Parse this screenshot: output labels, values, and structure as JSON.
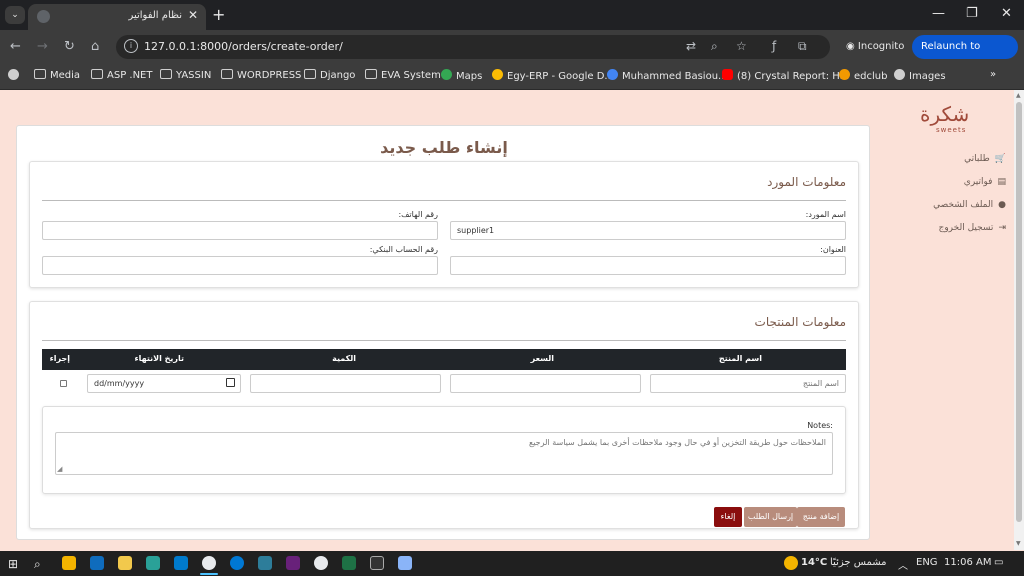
{
  "browser": {
    "tab_title": "نظام الفواتير",
    "url": "127.0.0.1:8000/orders/create-order/",
    "incognito_label": "Incognito",
    "relaunch_label": "Relaunch to update",
    "bookmarks": [
      "Media",
      "ASP .NET",
      "YASSIN",
      "WORDPRESS",
      "Django",
      "EVA System",
      "Maps",
      "Egy-ERP - Google D...",
      "Muhammed Basiou...",
      "(8) Crystal Report: H...",
      "edclub",
      "Images"
    ]
  },
  "sidebar": {
    "logo": "شكرة",
    "logo_sub": "sweets",
    "items": [
      {
        "label": "طلباتي",
        "icon": "cart-icon"
      },
      {
        "label": "فواتيري",
        "icon": "file-icon"
      },
      {
        "label": "الملف الشخصي",
        "icon": "user-icon"
      },
      {
        "label": "تسجيل الخروج",
        "icon": "logout-icon"
      }
    ]
  },
  "page": {
    "title": "إنشاء طلب جديد"
  },
  "supplier": {
    "section_title": "معلومات المورد",
    "name_label": "اسم المورد:",
    "name_value": "supplier1",
    "phone_label": "رقم الهاتف:",
    "phone_value": "",
    "address_label": "العنوان:",
    "address_value": "",
    "bank_label": "رقم الحساب البنكي:",
    "bank_value": ""
  },
  "products": {
    "section_title": "معلومات المنتجات",
    "columns": [
      "اسم المنتج",
      "السعر",
      "الكمية",
      "تاريخ الانتهاء",
      "إجراء"
    ],
    "row": {
      "name_placeholder": "اسم المنتج",
      "price": "",
      "quantity": "",
      "expiry_placeholder": "dd/mm/yyyy"
    },
    "notes_label": "Notes:",
    "notes_placeholder": "الملاحظات حول طريقة التخزين أو في حال وجود ملاحظات أخرى بما يشمل سياسة الرجيع"
  },
  "buttons": {
    "add_product": "إضافة منتج",
    "submit": "إرسال الطلب",
    "cancel": "إلغاء"
  },
  "taskbar": {
    "weather": "14°C",
    "weather_desc": "مشمس جزئيًا",
    "lang": "ENG",
    "time": "11:06 AM"
  },
  "colors": {
    "page_bg": "#fbe1d8",
    "accent": "#b88c7c",
    "danger": "#8a0d0d",
    "table_header": "#212529"
  }
}
